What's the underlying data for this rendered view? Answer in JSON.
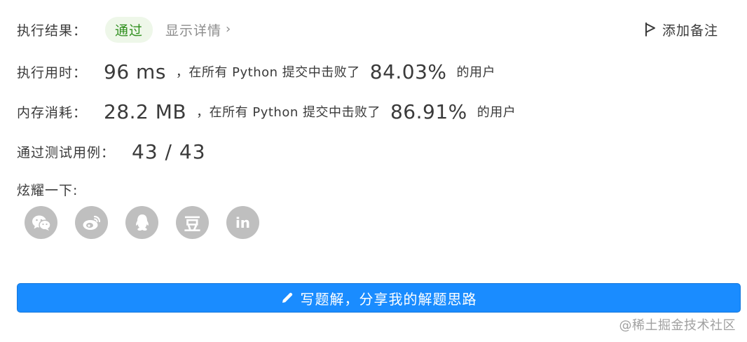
{
  "result": {
    "label": "执行结果：",
    "status": "通过",
    "detail_link": "显示详情",
    "detail_chevron": "›"
  },
  "note": {
    "label": "添加备注",
    "icon": "flag-icon"
  },
  "runtime": {
    "label": "执行用时：",
    "value": "96 ms",
    "middle": "，在所有 Python 提交中击败了",
    "percent": "84.03%",
    "tail": "的用户"
  },
  "memory": {
    "label": "内存消耗：",
    "value": "28.2 MB",
    "middle": "，在所有 Python 提交中击败了",
    "percent": "86.91%",
    "tail": "的用户"
  },
  "testcases": {
    "label": "通过测试用例：",
    "value": "43 / 43"
  },
  "share": {
    "label": "炫耀一下:",
    "icons": [
      {
        "name": "wechat-icon"
      },
      {
        "name": "weibo-icon"
      },
      {
        "name": "qq-icon"
      },
      {
        "name": "douban-icon",
        "glyph": "豆"
      },
      {
        "name": "linkedin-icon",
        "glyph": "in"
      }
    ]
  },
  "write_solution": {
    "label": "写题解，分享我的解题思路",
    "icon": "pencil-icon"
  },
  "watermark": "@稀土掘金技术社区",
  "colors": {
    "accent": "#1a8cff",
    "success_text": "#2f8f1e",
    "success_bg": "#eef7e9",
    "icon_gray": "#bfbfbf"
  }
}
